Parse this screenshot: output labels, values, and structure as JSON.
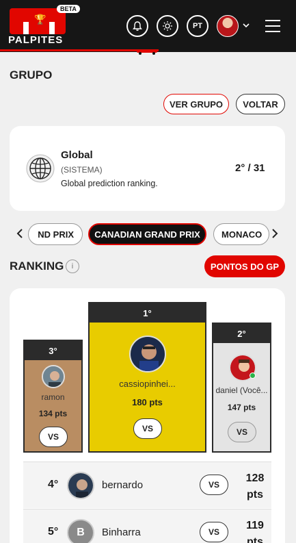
{
  "header": {
    "logo_text": "PALPITES",
    "beta": "BETA",
    "lang": "PT",
    "icons": [
      "bell-icon",
      "sun-icon",
      "chevron-down-icon",
      "menu-icon"
    ]
  },
  "group": {
    "title": "GRUPO",
    "ver_grupo": "VER GRUPO",
    "voltar": "VOLTAR",
    "name": "Global",
    "type": "(SISTEMA)",
    "description": "Global prediction ranking.",
    "position": "2° / 31"
  },
  "gp": {
    "prev": "ND PRIX",
    "current": "CANADIAN GRAND PRIX",
    "next": "MONACO"
  },
  "ranking": {
    "title": "RANKING",
    "info": "i",
    "points_button": "PONTOS DO GP",
    "vs_label": "VS",
    "podium": [
      {
        "pos": "1°",
        "name": "cassiopinhei...",
        "pts": "180 pts"
      },
      {
        "pos": "2°",
        "name": "daniel (Você...",
        "pts": "147 pts"
      },
      {
        "pos": "3°",
        "name": "ramon",
        "pts": "134 pts"
      }
    ],
    "rows": [
      {
        "pos": "4°",
        "name": "bernardo",
        "pts_value": "128",
        "pts_unit": "pts"
      },
      {
        "pos": "5°",
        "name": "Binharra",
        "initial": "B",
        "pts_value": "119",
        "pts_unit": "pts"
      }
    ]
  },
  "colors": {
    "accent": "#e10600",
    "gold": "#e8cc00",
    "silver": "#e4e4e4",
    "bronze": "#b98d62",
    "dark": "#161616"
  }
}
